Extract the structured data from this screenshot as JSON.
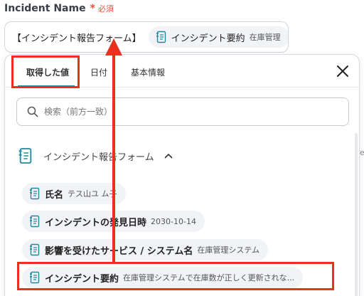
{
  "field": {
    "label": "Incident Name",
    "required_mark": "*",
    "required_text": "必須",
    "value_text": "【インシデント報告フォーム】",
    "chip_label": "インシデント要約",
    "chip_value": "在庫管理"
  },
  "tabs": [
    {
      "label": "取得した値",
      "active": true
    },
    {
      "label": "日付",
      "active": false
    },
    {
      "label": "基本情報",
      "active": false
    }
  ],
  "search": {
    "placeholder": "検索（前方一致）"
  },
  "group": {
    "title": "インシデント報告フォーム"
  },
  "items": [
    {
      "label": "氏名",
      "value": "テス山ユ ム子"
    },
    {
      "label": "インシデントの発見日時",
      "value": "2030-10-14"
    },
    {
      "label": "影響を受けたサービス / システム名",
      "value": "在庫管理システム"
    },
    {
      "label": "インシデント要約",
      "value": "在庫管理システムで在庫数が正しく更新されな..."
    }
  ],
  "side_fragment": "e",
  "colors": {
    "accent": "#1e8aa0",
    "annotation": "#e8321f",
    "required": "#e8503a"
  }
}
